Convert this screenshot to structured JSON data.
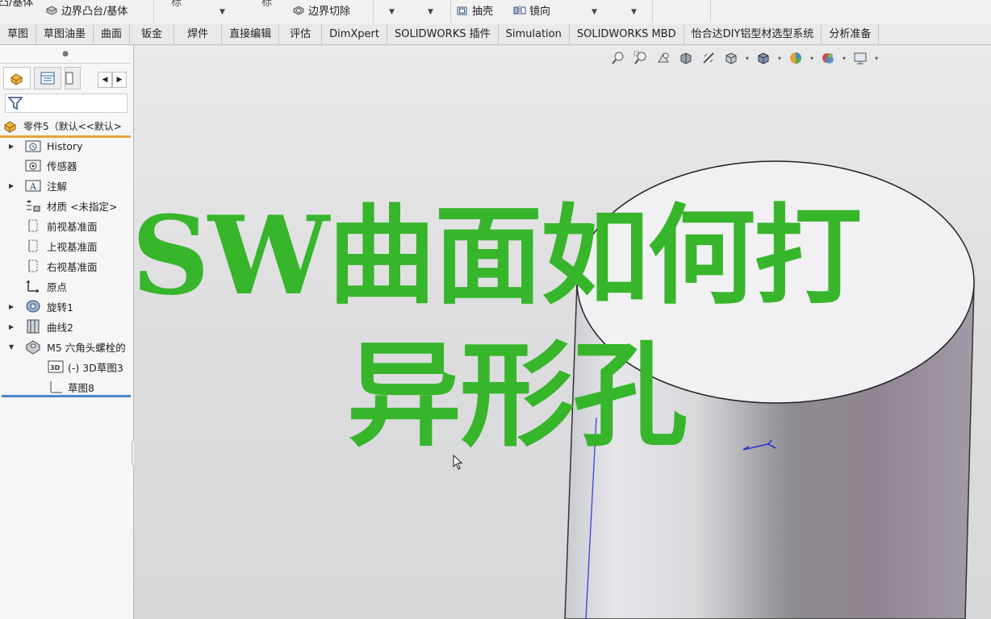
{
  "ribbon": {
    "cut_top_left": "凸/基体",
    "boss_base": "边界凸台/基体",
    "cut_top_mid1": "标",
    "cut_top_mid2": "标",
    "boundary_cut": "边界切除",
    "shell": "抽壳",
    "mirror": "镜向"
  },
  "tabs": [
    "草图",
    "草图油墨",
    "曲面",
    "钣金",
    "焊件",
    "直接编辑",
    "评估",
    "DimXpert",
    "SOLIDWORKS 插件",
    "Simulation",
    "SOLIDWORKS MBD",
    "怡合达DIY铝型材选型系统",
    "分析准备"
  ],
  "feature_tree": {
    "part_name": "零件5（默认<<默认>",
    "items": [
      {
        "label": "History",
        "icon": "history-folder-icon",
        "expandable": true
      },
      {
        "label": "传感器",
        "icon": "sensor-icon",
        "expandable": false
      },
      {
        "label": "注解",
        "icon": "annotation-icon",
        "expandable": true
      },
      {
        "label": "材质 <未指定>",
        "icon": "material-icon",
        "expandable": false
      },
      {
        "label": "前视基准面",
        "icon": "plane-icon",
        "expandable": false
      },
      {
        "label": "上视基准面",
        "icon": "plane-icon",
        "expandable": false
      },
      {
        "label": "右视基准面",
        "icon": "plane-icon",
        "expandable": false
      },
      {
        "label": "原点",
        "icon": "origin-icon",
        "expandable": false
      },
      {
        "label": "旋转1",
        "icon": "revolve-icon",
        "expandable": true
      },
      {
        "label": "曲线2",
        "icon": "curve-icon",
        "expandable": true
      },
      {
        "label": "M5 六角头螺栓的",
        "icon": "hole-wizard-icon",
        "expandable": true,
        "expanded": true
      },
      {
        "label": "(-) 3D草图3",
        "icon": "3d-sketch-icon",
        "child": true
      },
      {
        "label": "草图8",
        "icon": "sketch-icon",
        "child": true
      }
    ]
  },
  "overlay_title": {
    "line1": "SW曲面如何打",
    "line2": "异形孔",
    "color": "#37b52b"
  },
  "colors": {
    "tree_accent": "#e2a53a",
    "tree_end_line": "#4a86c8"
  }
}
